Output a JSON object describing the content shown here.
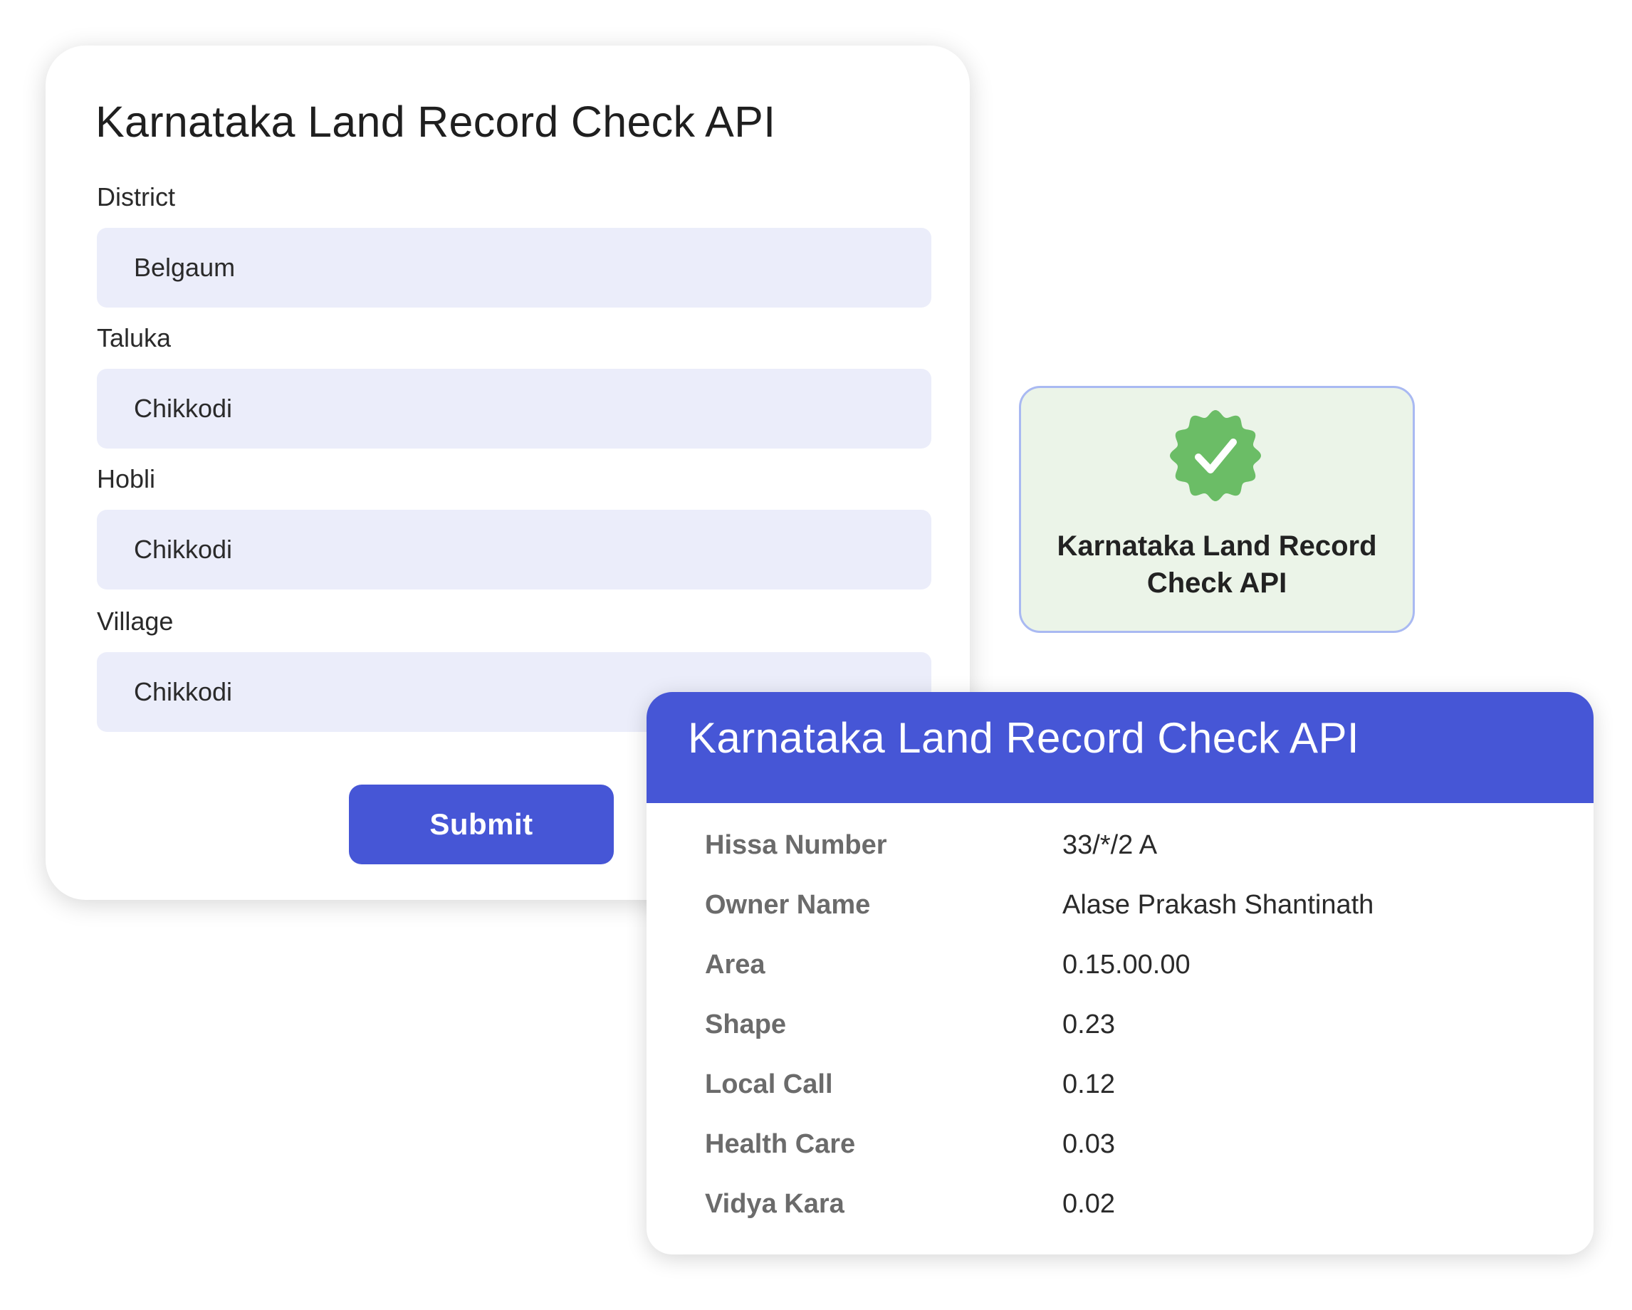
{
  "form": {
    "title": "Karnataka Land Record Check API",
    "fields": [
      {
        "label": "District",
        "value": "Belgaum"
      },
      {
        "label": "Taluka",
        "value": "Chikkodi"
      },
      {
        "label": "Hobli",
        "value": "Chikkodi"
      },
      {
        "label": "Village",
        "value": "Chikkodi"
      }
    ],
    "submit_label": "Submit"
  },
  "badge": {
    "icon": "verified-badge-icon",
    "color": "#6bbd66",
    "title_line1": "Karnataka Land Record",
    "title_line2": "Check API"
  },
  "result": {
    "title": "Karnataka Land Record Check API",
    "rows": [
      {
        "key": "Hissa Number",
        "value": "33/*/2 A"
      },
      {
        "key": "Owner Name",
        "value": "Alase Prakash Shantinath"
      },
      {
        "key": "Area",
        "value": "0.15.00.00"
      },
      {
        "key": "Shape",
        "value": "0.23"
      },
      {
        "key": "Local Call",
        "value": "0.12"
      },
      {
        "key": "Health Care",
        "value": "0.03"
      },
      {
        "key": "Vidya Kara",
        "value": "0.02"
      }
    ]
  },
  "colors": {
    "accent": "#4656d6",
    "input_bg": "#ebedfa",
    "badge_bg": "#ebf4e8",
    "badge_border": "#a9b9f2"
  }
}
